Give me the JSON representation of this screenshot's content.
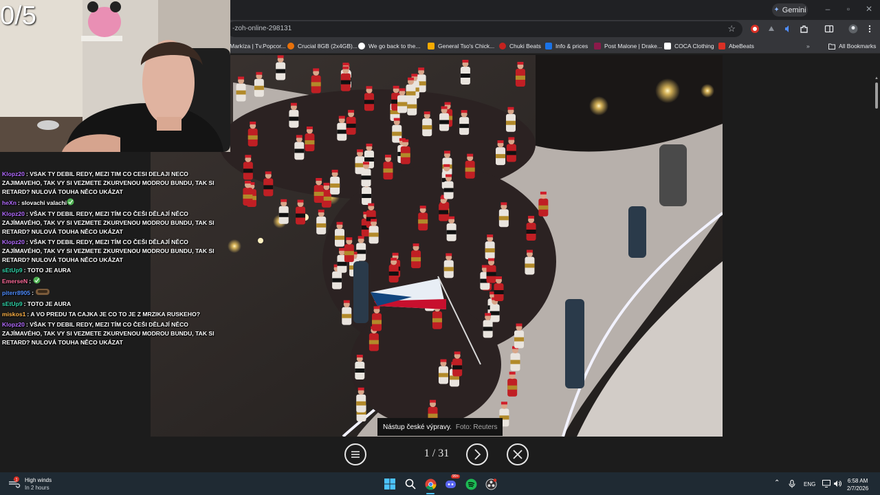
{
  "overlay": {
    "counter": "0/5"
  },
  "browser": {
    "gemini_label": "Gemini",
    "url": "-zoh-online-298131",
    "bookmarks": [
      {
        "label": "Markíza | Tv.Popcor...",
        "color": "#e8eaed"
      },
      {
        "label": "Crucial 8GB (2x4GB)...",
        "color": "#e8710a"
      },
      {
        "label": "We go back to the...",
        "color": "#ffffff"
      },
      {
        "label": "General Tso's Chick...",
        "color": "#f9ab00"
      },
      {
        "label": "Chuki Beats",
        "color": "#c5221f"
      },
      {
        "label": "Info & prices",
        "color": "#1a73e8"
      },
      {
        "label": "Post Malone | Drake...",
        "color": "#8b1a4a"
      },
      {
        "label": "COCA Clothing",
        "color": "#ffffff"
      },
      {
        "label": "AbeBeats",
        "color": "#d93025"
      }
    ],
    "all_bookmarks_label": "All Bookmarks"
  },
  "gallery": {
    "caption": "Nástup české výpravy.",
    "credit": "Foto: Reuters",
    "counter": "1 / 31"
  },
  "chat": [
    {
      "user": "Klopz20",
      "color": "#b36bff",
      "text": "VSAK TY DEBIL REDY, MEZI TIM CO CESI DELAJI NECO ZAJIMAVEHO, TAK VY SI VEZMETE ZKURVENOU MODROU BUNDU, TAK SI RETARD? NULOVÁ TOUHA NĚCO UKÁZAT"
    },
    {
      "user": "heXn",
      "color": "#b36bff",
      "text": "slovachi valachi",
      "emote": "green"
    },
    {
      "user": "Klopz20",
      "color": "#b36bff",
      "text": "VŠAK TY DEBIL REDY, MEZI TÍM CO ČEŠI DĚLAJÍ NĚCO ZAJÍMAVÉHO, TAK VY SI VEZMETE ZKURVENOU MODROU BUNDU, TAK SI RETARD? NULOVÁ TOUHA NĚCO UKÁZAT"
    },
    {
      "user": "Klopz20",
      "color": "#b36bff",
      "text": "VŠAK TY DEBIL REDY, MEZI TÍM CO ČEŠI DĚLAJÍ NĚCO ZAJÍMAVÉHO, TAK VY SI VEZMETE ZKURVENOU MODROU BUNDU, TAK SI RETARD? NULOVÁ TOUHA NĚCO UKÁZAT"
    },
    {
      "user": "sEtUp9",
      "color": "#2fd3a8",
      "text": "TOTO JE AURA"
    },
    {
      "user": "EmerseN",
      "color": "#ff6b9a",
      "text": "",
      "emote": "green"
    },
    {
      "user": "piterr8905",
      "color": "#4f8dff",
      "text": "",
      "emote": "brown"
    },
    {
      "user": "sEtUp9",
      "color": "#2fd3a8",
      "text": "TOTO JE AURA"
    },
    {
      "user": "miskos1",
      "color": "#ffb347",
      "text": "A VO PREDU TA CAJKA JE CO TO JE Z MRZIKA RUSKEHO?"
    },
    {
      "user": "Klopz20",
      "color": "#b36bff",
      "text": "VŠAK TY DEBIL REDY, MEZI TÍM CO ČEŠI DĚLAJÍ NĚCO ZAJÍMAVÉHO, TAK VY SI VEZMETE ZKURVENOU MODROU BUNDU, TAK SI RETARD? NULOVÁ TOUHA NĚCO UKÁZAT"
    }
  ],
  "taskbar": {
    "weather_title": "High winds",
    "weather_sub": "In 2 hours",
    "weather_badge": "1",
    "discord_badge": "99+",
    "lang": "ENG",
    "time": "6:58 AM",
    "date": "2/7/2026"
  }
}
